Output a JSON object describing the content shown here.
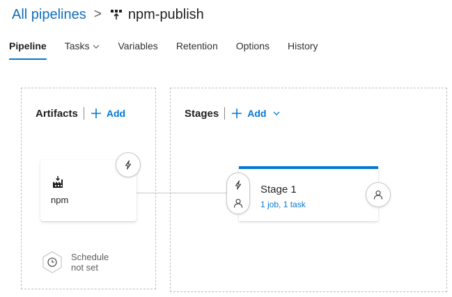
{
  "breadcrumb": {
    "parent": "All pipelines",
    "separator": ">",
    "current": "npm-publish",
    "current_icon": "pipeline-icon"
  },
  "tabs": [
    {
      "label": "Pipeline",
      "active": true
    },
    {
      "label": "Tasks",
      "has_dropdown": true
    },
    {
      "label": "Variables"
    },
    {
      "label": "Retention"
    },
    {
      "label": "Options"
    },
    {
      "label": "History"
    }
  ],
  "artifacts": {
    "title": "Artifacts",
    "add_label": "Add",
    "items": [
      {
        "name": "npm",
        "icon": "npm-package-icon",
        "trigger_icon": "lightning-icon"
      }
    ],
    "schedule": {
      "line1": "Schedule",
      "line2": "not set",
      "icon": "clock-icon"
    }
  },
  "stages": {
    "title": "Stages",
    "add_label": "Add",
    "items": [
      {
        "name": "Stage 1",
        "summary": "1 job, 1 task",
        "pre_icons": [
          "lightning-icon",
          "person-icon"
        ],
        "post_icon": "person-icon"
      }
    ]
  },
  "colors": {
    "accent": "#0078d4",
    "link": "#106ebe",
    "text": "#201f1e",
    "muted": "#605e5c",
    "border": "#c8c6c4"
  }
}
